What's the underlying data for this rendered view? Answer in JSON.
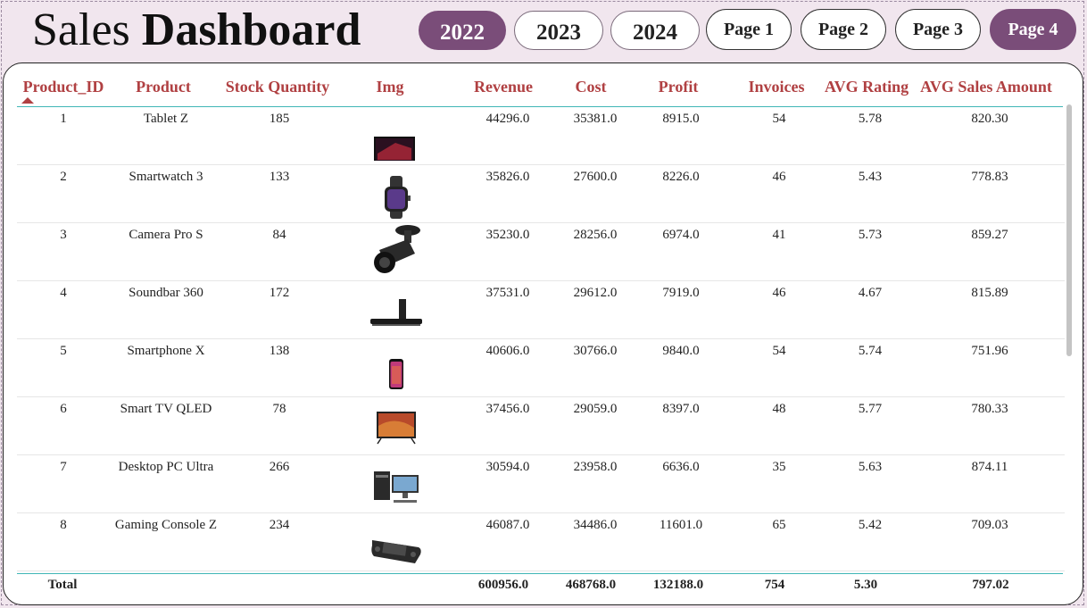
{
  "title": {
    "light": "Sales",
    "bold": "Dashboard"
  },
  "years": [
    {
      "label": "2022",
      "active": true
    },
    {
      "label": "2023",
      "active": false
    },
    {
      "label": "2024",
      "active": false
    }
  ],
  "pages": [
    {
      "label": "Page 1",
      "active": false
    },
    {
      "label": "Page 2",
      "active": false
    },
    {
      "label": "Page 3",
      "active": false
    },
    {
      "label": "Page 4",
      "active": true
    }
  ],
  "table": {
    "headers": [
      "Product_ID",
      "Product",
      "Stock Quantity",
      "Img",
      "Revenue",
      "Cost",
      "Profit",
      "Invoices",
      "AVG Rating",
      "AVG Sales Amount"
    ],
    "sorted_column": "Product_ID",
    "rows": [
      {
        "id": "1",
        "product": "Tablet Z",
        "stock": "185",
        "img": "tablet-icon",
        "revenue": "44296.0",
        "cost": "35381.0",
        "profit": "8915.0",
        "invoices": "54",
        "rating": "5.78",
        "avg_sales": "820.30"
      },
      {
        "id": "2",
        "product": "Smartwatch 3",
        "stock": "133",
        "img": "smartwatch-icon",
        "revenue": "35826.0",
        "cost": "27600.0",
        "profit": "8226.0",
        "invoices": "46",
        "rating": "5.43",
        "avg_sales": "778.83"
      },
      {
        "id": "3",
        "product": "Camera Pro S",
        "stock": "84",
        "img": "camera-icon",
        "revenue": "35230.0",
        "cost": "28256.0",
        "profit": "6974.0",
        "invoices": "41",
        "rating": "5.73",
        "avg_sales": "859.27"
      },
      {
        "id": "4",
        "product": "Soundbar 360",
        "stock": "172",
        "img": "soundbar-icon",
        "revenue": "37531.0",
        "cost": "29612.0",
        "profit": "7919.0",
        "invoices": "46",
        "rating": "4.67",
        "avg_sales": "815.89"
      },
      {
        "id": "5",
        "product": "Smartphone X",
        "stock": "138",
        "img": "smartphone-icon",
        "revenue": "40606.0",
        "cost": "30766.0",
        "profit": "9840.0",
        "invoices": "54",
        "rating": "5.74",
        "avg_sales": "751.96"
      },
      {
        "id": "6",
        "product": "Smart TV QLED",
        "stock": "78",
        "img": "tv-icon",
        "revenue": "37456.0",
        "cost": "29059.0",
        "profit": "8397.0",
        "invoices": "48",
        "rating": "5.77",
        "avg_sales": "780.33"
      },
      {
        "id": "7",
        "product": "Desktop PC Ultra",
        "stock": "266",
        "img": "desktop-pc-icon",
        "revenue": "30594.0",
        "cost": "23958.0",
        "profit": "6636.0",
        "invoices": "35",
        "rating": "5.63",
        "avg_sales": "874.11"
      },
      {
        "id": "8",
        "product": "Gaming Console Z",
        "stock": "234",
        "img": "game-console-icon",
        "revenue": "46087.0",
        "cost": "34486.0",
        "profit": "11601.0",
        "invoices": "65",
        "rating": "5.42",
        "avg_sales": "709.03"
      }
    ],
    "totals": {
      "label": "Total",
      "revenue": "600956.0",
      "cost": "468768.0",
      "profit": "132188.0",
      "invoices": "754",
      "rating": "5.30",
      "avg_sales": "797.02"
    }
  },
  "colors": {
    "accent": "#7a4d79",
    "header_text": "#b04042",
    "background": "#f1e6ee",
    "divider": "#3fb6b6"
  }
}
